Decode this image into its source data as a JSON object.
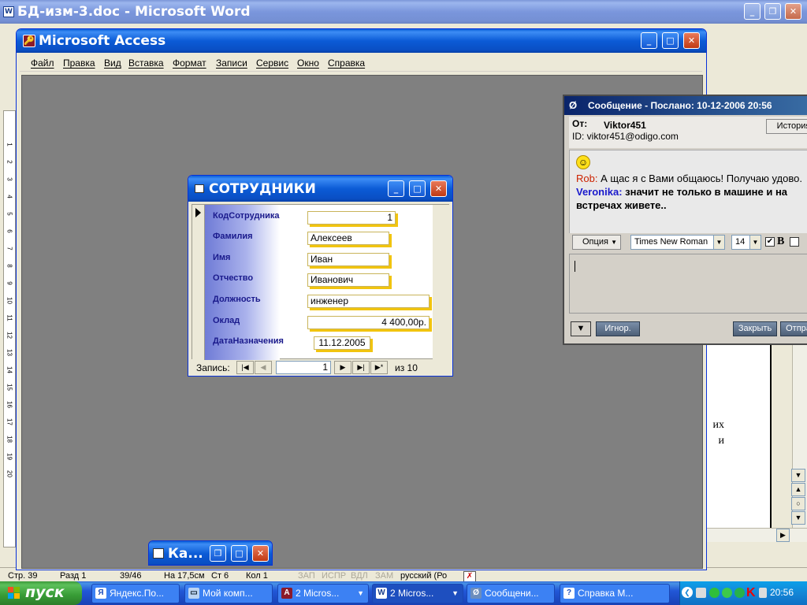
{
  "word": {
    "title": "БД-изм-3.doc - Microsoft Word",
    "page_text": [
      "их",
      "и"
    ],
    "status": {
      "page": "Стр. 39",
      "section": "Разд 1",
      "pages": "39/46",
      "at": "На 17,5см",
      "line": "Ст 6",
      "col": "Кол 1",
      "rec": "ЗАП",
      "trk": "ИСПР",
      "ext": "ВДЛ",
      "ovr": "ЗАМ",
      "lang": "русский (Ро"
    },
    "ruler_numbers": [
      "1",
      "2",
      "3",
      "4",
      "5",
      "6",
      "7",
      "8",
      "9",
      "10",
      "11",
      "12",
      "13",
      "14",
      "15",
      "16",
      "17",
      "18",
      "19",
      "20"
    ]
  },
  "access": {
    "title": "Microsoft Access",
    "menu": [
      "Файл",
      "Правка",
      "Вид",
      "Вставка",
      "Формат",
      "Записи",
      "Сервис",
      "Окно",
      "Справка"
    ]
  },
  "form": {
    "title": "СОТРУДНИКИ",
    "fields": [
      {
        "label": "КодСотрудника",
        "value": "1"
      },
      {
        "label": "Фамилия",
        "value": "Алексеев"
      },
      {
        "label": "Имя",
        "value": "Иван"
      },
      {
        "label": "Отчество",
        "value": "Иванович"
      },
      {
        "label": "Должность",
        "value": "инженер"
      },
      {
        "label": "Оклад",
        "value": "4 400,00р."
      },
      {
        "label": "ДатаНазначения",
        "value": "11.12.2005"
      }
    ],
    "nav": {
      "label": "Запись:",
      "current": "1",
      "total": "из 10"
    }
  },
  "minimized": {
    "title": "Ка..."
  },
  "chat": {
    "title": "Сообщение - Послано: 10-12-2006 20:56",
    "from_label": "От:",
    "from_name": "Viktor451",
    "id_line": "ID: viktor451@odigo.com",
    "history_button": "История",
    "messages": [
      {
        "sender": "Rob:",
        "text": "А щас я с Вами общаюсь! Получаю удово.",
        "sender_color": "#cc2200"
      },
      {
        "sender": "Veronika:",
        "text": "значит не только в машине и на",
        "sender_color": "#1a1acc"
      }
    ],
    "message_cont": "встречах живете..",
    "options_button": "Опция",
    "font_name": "Times New Roman",
    "font_size": "14",
    "bold_label": "B",
    "ignore_button": "Игнор.",
    "close_button": "Закрыть",
    "send_button": "Отпра"
  },
  "taskbar": {
    "start": "пуск",
    "tasks": [
      {
        "label": "Яндекс.По...",
        "active": false
      },
      {
        "label": "Мой комп...",
        "active": false
      },
      {
        "label": "2 Micros...",
        "active": false
      },
      {
        "label": "2 Micros...",
        "active": true
      },
      {
        "label": "Сообщени...",
        "active": false
      },
      {
        "label": "Справка М...",
        "active": false
      }
    ],
    "clock": "20:56"
  }
}
